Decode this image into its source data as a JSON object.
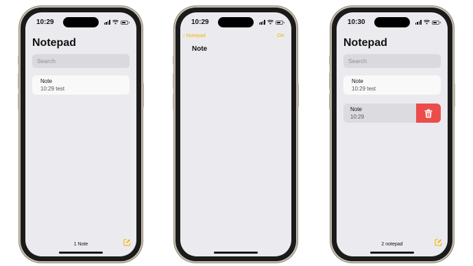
{
  "colors": {
    "accent": "#f4b400",
    "delete": "#eb4d4b",
    "screen_bg": "#ebebef"
  },
  "phone1": {
    "time": "10:29",
    "title": "Notepad",
    "search_placeholder": "Search",
    "notes": [
      {
        "title": "Note",
        "subtitle": "10:29 test"
      }
    ],
    "count": "1 Note",
    "compose_icon": "compose-icon"
  },
  "phone2": {
    "time": "10:29",
    "back_label": "Notepad",
    "ok_label": "OK",
    "note_title": "Note"
  },
  "phone3": {
    "time": "10:30",
    "title": "Notepad",
    "search_placeholder": "Search",
    "notes": [
      {
        "title": "Note",
        "subtitle": "10:29 test"
      },
      {
        "title": "Note",
        "subtitle": "10:29"
      }
    ],
    "delete_icon": "trash-icon",
    "count": "2 notepad",
    "compose_icon": "compose-icon"
  }
}
